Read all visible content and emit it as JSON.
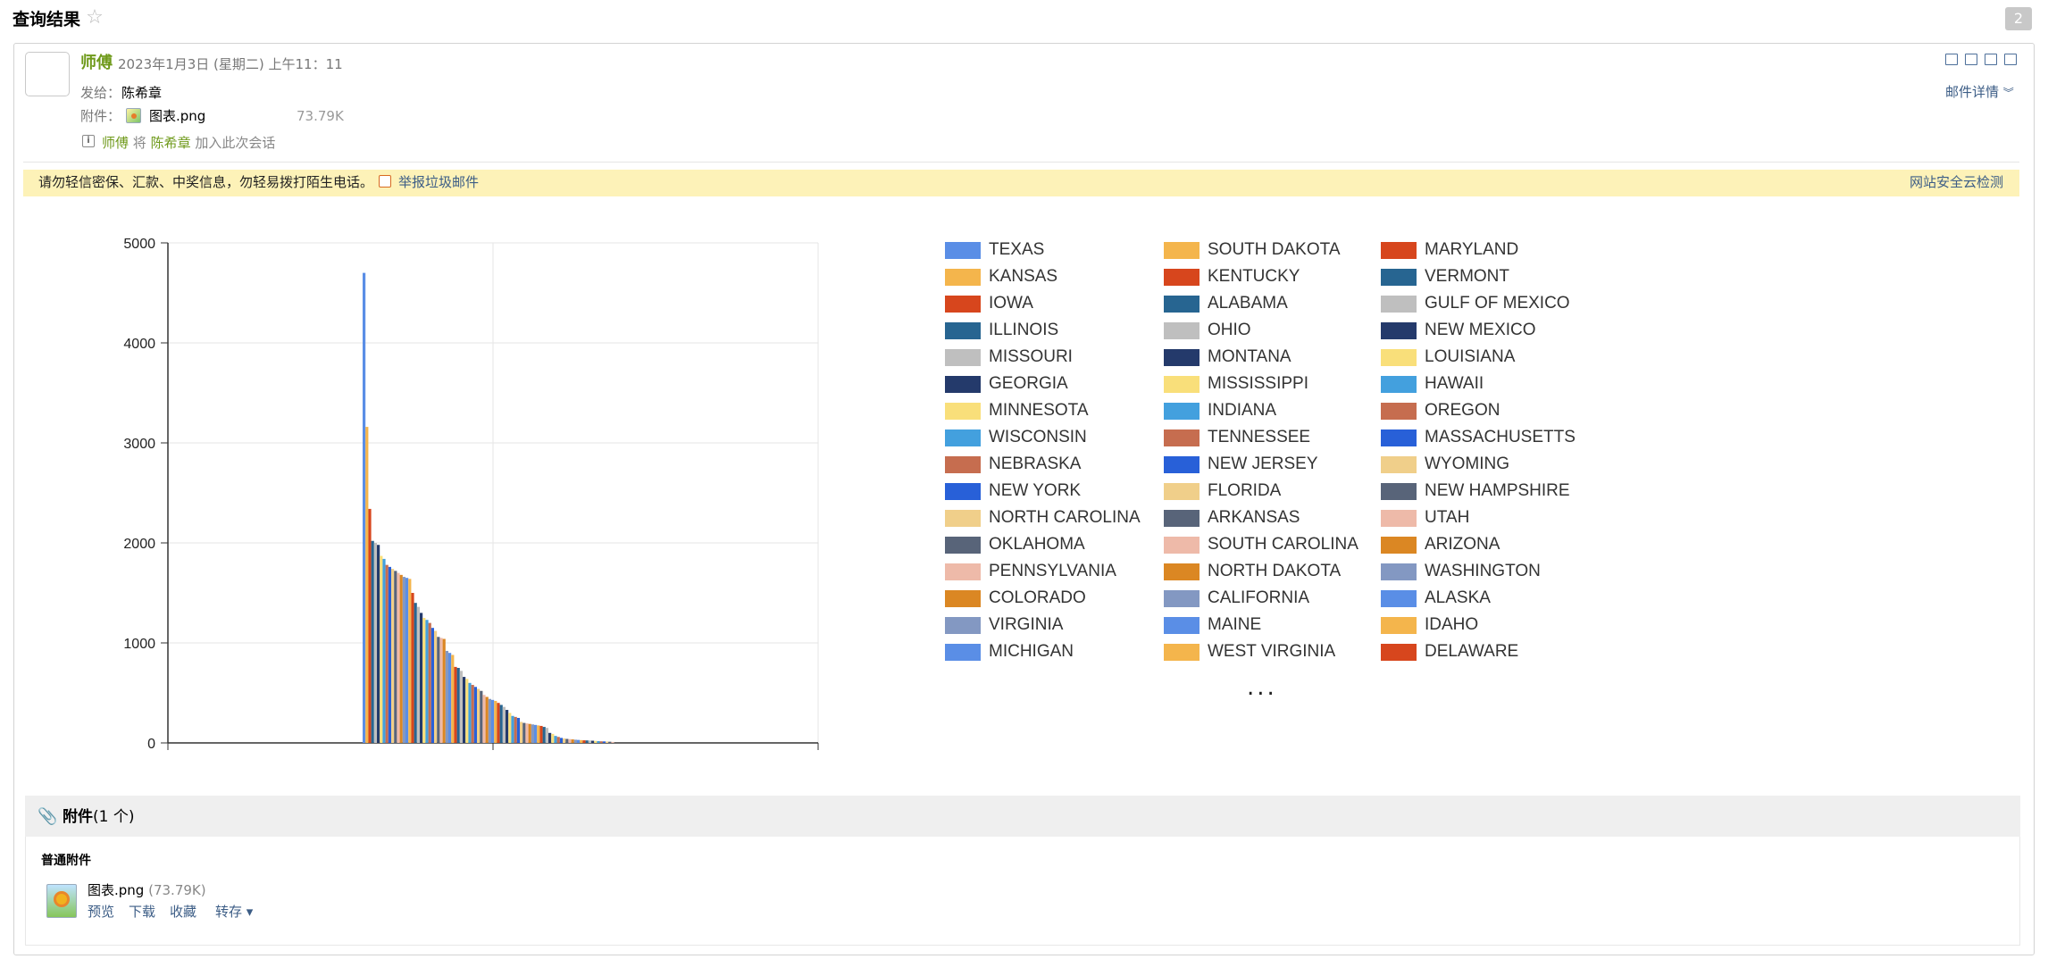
{
  "page": {
    "title": "查询结果",
    "message_count": "2"
  },
  "header": {
    "sender": "师傅",
    "time": "2023年1月3日 (星期二) 上午11：11",
    "to_label": "发给：",
    "to_value": "陈希章",
    "attach_label": "附件：",
    "attach_name": "图表.png",
    "attach_size": "73.79K",
    "info_icon": "i",
    "convo_sender": "师傅",
    "convo_mid": "将",
    "convo_target": "陈希章",
    "convo_action": "加入此次会话",
    "detail_link": "邮件详情"
  },
  "warning": {
    "text": "请勿轻信密保、汇款、中奖信息，勿轻易拨打陌生电话。",
    "report_link": "举报垃圾邮件",
    "security_link": "网站安全云检测"
  },
  "chart_data": {
    "type": "bar",
    "title": "",
    "xlabel": "",
    "ylabel": "",
    "ylim": [
      0,
      5000
    ],
    "yticks": [
      "0",
      "1000",
      "2000",
      "3000",
      "4000",
      "5000"
    ],
    "grid": true,
    "legend_placement": "right",
    "legend_more": "...",
    "series": [
      {
        "name": "TEXAS",
        "value": 4700,
        "color": "#5a8ee6"
      },
      {
        "name": "KANSAS",
        "value": 3160,
        "color": "#f4b54c"
      },
      {
        "name": "IOWA",
        "value": 2340,
        "color": "#d7461d"
      },
      {
        "name": "ILLINOIS",
        "value": 2020,
        "color": "#276591"
      },
      {
        "name": "MISSOURI",
        "value": 2000,
        "color": "#bfbfbf"
      },
      {
        "name": "GEORGIA",
        "value": 1980,
        "color": "#243a6b"
      },
      {
        "name": "MINNESOTA",
        "value": 1870,
        "color": "#f9df7a"
      },
      {
        "name": "WISCONSIN",
        "value": 1840,
        "color": "#43a0de"
      },
      {
        "name": "NEBRASKA",
        "value": 1780,
        "color": "#c66d4f"
      },
      {
        "name": "NEW YORK",
        "value": 1760,
        "color": "#2860d8"
      },
      {
        "name": "NORTH CAROLINA",
        "value": 1740,
        "color": "#f0cf8a"
      },
      {
        "name": "OKLAHOMA",
        "value": 1720,
        "color": "#586479"
      },
      {
        "name": "PENNSYLVANIA",
        "value": 1700,
        "color": "#eebaa9"
      },
      {
        "name": "COLORADO",
        "value": 1680,
        "color": "#db8723"
      },
      {
        "name": "VIRGINIA",
        "value": 1660,
        "color": "#8398c2"
      },
      {
        "name": "MICHIGAN",
        "value": 1650,
        "color": "#5a8ee6"
      },
      {
        "name": "SOUTH DAKOTA",
        "value": 1640,
        "color": "#f4b54c"
      },
      {
        "name": "KENTUCKY",
        "value": 1500,
        "color": "#d7461d"
      },
      {
        "name": "ALABAMA",
        "value": 1400,
        "color": "#276591"
      },
      {
        "name": "OHIO",
        "value": 1360,
        "color": "#bfbfbf"
      },
      {
        "name": "MONTANA",
        "value": 1300,
        "color": "#243a6b"
      },
      {
        "name": "MISSISSIPPI",
        "value": 1250,
        "color": "#f9df7a"
      },
      {
        "name": "INDIANA",
        "value": 1230,
        "color": "#43a0de"
      },
      {
        "name": "TENNESSEE",
        "value": 1200,
        "color": "#c66d4f"
      },
      {
        "name": "NEW JERSEY",
        "value": 1150,
        "color": "#2860d8"
      },
      {
        "name": "FLORIDA",
        "value": 1120,
        "color": "#f0cf8a"
      },
      {
        "name": "ARKANSAS",
        "value": 1060,
        "color": "#586479"
      },
      {
        "name": "SOUTH CAROLINA",
        "value": 1050,
        "color": "#eebaa9"
      },
      {
        "name": "NORTH DAKOTA",
        "value": 1040,
        "color": "#db8723"
      },
      {
        "name": "CALIFORNIA",
        "value": 920,
        "color": "#8398c2"
      },
      {
        "name": "MAINE",
        "value": 900,
        "color": "#5a8ee6"
      },
      {
        "name": "WEST VIRGINIA",
        "value": 880,
        "color": "#f4b54c"
      },
      {
        "name": "MARYLAND",
        "value": 760,
        "color": "#d7461d"
      },
      {
        "name": "VERMONT",
        "value": 750,
        "color": "#276591"
      },
      {
        "name": "GULF OF MEXICO",
        "value": 720,
        "color": "#bfbfbf"
      },
      {
        "name": "NEW MEXICO",
        "value": 660,
        "color": "#243a6b"
      },
      {
        "name": "LOUISIANA",
        "value": 640,
        "color": "#f9df7a"
      },
      {
        "name": "HAWAII",
        "value": 600,
        "color": "#43a0de"
      },
      {
        "name": "OREGON",
        "value": 580,
        "color": "#c66d4f"
      },
      {
        "name": "MASSACHUSETTS",
        "value": 560,
        "color": "#2860d8"
      },
      {
        "name": "WYOMING",
        "value": 540,
        "color": "#f0cf8a"
      },
      {
        "name": "NEW HAMPSHIRE",
        "value": 520,
        "color": "#586479"
      },
      {
        "name": "UTAH",
        "value": 480,
        "color": "#eebaa9"
      },
      {
        "name": "ARIZONA",
        "value": 460,
        "color": "#db8723"
      },
      {
        "name": "WASHINGTON",
        "value": 440,
        "color": "#8398c2"
      },
      {
        "name": "ALASKA",
        "value": 430,
        "color": "#5a8ee6"
      },
      {
        "name": "IDAHO",
        "value": 420,
        "color": "#f4b54c"
      },
      {
        "name": "DELAWARE",
        "value": 400,
        "color": "#d7461d"
      },
      {
        "name": "",
        "value": 380,
        "color": "#276591"
      },
      {
        "name": "",
        "value": 360,
        "color": "#bfbfbf"
      },
      {
        "name": "",
        "value": 330,
        "color": "#243a6b"
      },
      {
        "name": "",
        "value": 300,
        "color": "#f9df7a"
      },
      {
        "name": "",
        "value": 270,
        "color": "#43a0de"
      },
      {
        "name": "",
        "value": 260,
        "color": "#c66d4f"
      },
      {
        "name": "",
        "value": 250,
        "color": "#2860d8"
      },
      {
        "name": "",
        "value": 210,
        "color": "#f0cf8a"
      },
      {
        "name": "",
        "value": 200,
        "color": "#586479"
      },
      {
        "name": "",
        "value": 195,
        "color": "#eebaa9"
      },
      {
        "name": "",
        "value": 190,
        "color": "#db8723"
      },
      {
        "name": "",
        "value": 185,
        "color": "#8398c2"
      },
      {
        "name": "",
        "value": 180,
        "color": "#5a8ee6"
      },
      {
        "name": "",
        "value": 175,
        "color": "#f4b54c"
      },
      {
        "name": "",
        "value": 170,
        "color": "#d7461d"
      },
      {
        "name": "",
        "value": 160,
        "color": "#276591"
      },
      {
        "name": "",
        "value": 150,
        "color": "#bfbfbf"
      },
      {
        "name": "",
        "value": 100,
        "color": "#243a6b"
      },
      {
        "name": "",
        "value": 90,
        "color": "#f9df7a"
      },
      {
        "name": "",
        "value": 70,
        "color": "#43a0de"
      },
      {
        "name": "",
        "value": 60,
        "color": "#c66d4f"
      },
      {
        "name": "",
        "value": 50,
        "color": "#2860d8"
      },
      {
        "name": "",
        "value": 45,
        "color": "#f0cf8a"
      },
      {
        "name": "",
        "value": 40,
        "color": "#586479"
      },
      {
        "name": "",
        "value": 38,
        "color": "#eebaa9"
      },
      {
        "name": "",
        "value": 35,
        "color": "#db8723"
      },
      {
        "name": "",
        "value": 32,
        "color": "#8398c2"
      },
      {
        "name": "",
        "value": 30,
        "color": "#5a8ee6"
      },
      {
        "name": "",
        "value": 28,
        "color": "#f4b54c"
      },
      {
        "name": "",
        "value": 26,
        "color": "#d7461d"
      },
      {
        "name": "",
        "value": 25,
        "color": "#276591"
      },
      {
        "name": "",
        "value": 24,
        "color": "#bfbfbf"
      },
      {
        "name": "",
        "value": 22,
        "color": "#243a6b"
      },
      {
        "name": "",
        "value": 20,
        "color": "#f9df7a"
      },
      {
        "name": "",
        "value": 18,
        "color": "#43a0de"
      },
      {
        "name": "",
        "value": 16,
        "color": "#c66d4f"
      },
      {
        "name": "",
        "value": 15,
        "color": "#2860d8"
      },
      {
        "name": "",
        "value": 14,
        "color": "#f0cf8a"
      },
      {
        "name": "",
        "value": 12,
        "color": "#586479"
      },
      {
        "name": "",
        "value": 10,
        "color": "#eebaa9"
      }
    ]
  },
  "attachments": {
    "title": "附件",
    "count_text": "(1 个)",
    "sub_title": "普通附件",
    "file_name": "图表.png",
    "file_size": "(73.79K)",
    "actions": [
      "预览",
      "下载",
      "收藏",
      "转存 ▾"
    ]
  }
}
